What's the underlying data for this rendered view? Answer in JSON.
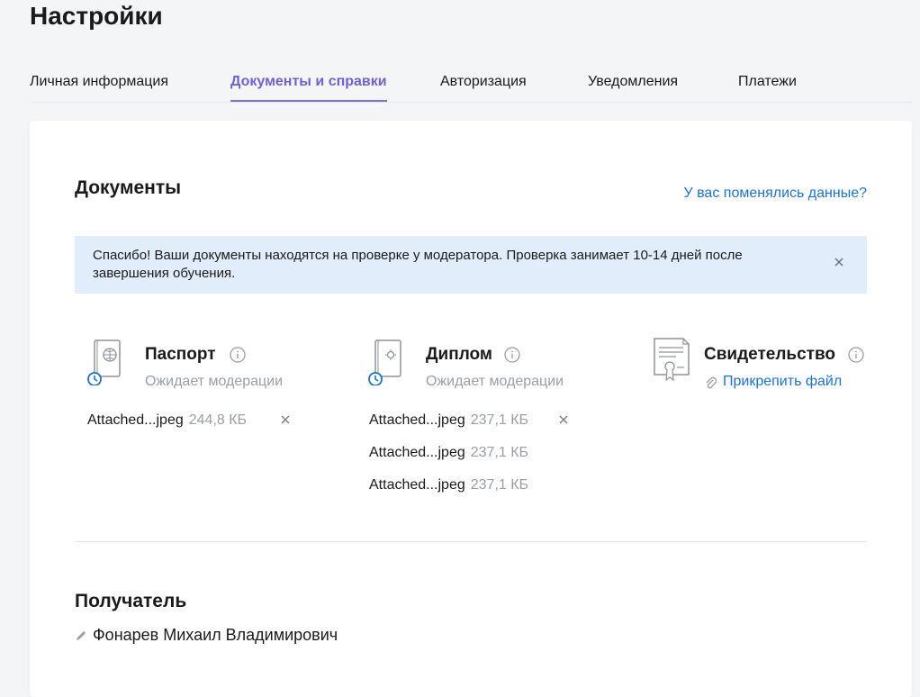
{
  "page": {
    "title": "Настройки"
  },
  "tabs": [
    {
      "label": "Личная информация",
      "active": false
    },
    {
      "label": "Документы и справки",
      "active": true
    },
    {
      "label": "Авторизация",
      "active": false
    },
    {
      "label": "Уведомления",
      "active": false
    },
    {
      "label": "Платежи",
      "active": false
    }
  ],
  "documents": {
    "title": "Документы",
    "changed_link": "У вас поменялись данные?",
    "notice": "Спасибо! Ваши документы находятся на проверке у модератора. Проверка занимает 10-14 дней после завершения обучения.",
    "notice_close_icon": "close-icon",
    "items": [
      {
        "name": "Паспорт",
        "status": "Ожидает модерации",
        "icon": "passport-icon",
        "files": [
          {
            "name": "Attached...jpeg",
            "size": "244,8 КБ",
            "removable": true
          }
        ]
      },
      {
        "name": "Диплом",
        "status": "Ожидает модерации",
        "icon": "diploma-icon",
        "files": [
          {
            "name": "Attached...jpeg",
            "size": "237,1 КБ",
            "removable": true
          },
          {
            "name": "Attached...jpeg",
            "size": "237,1 КБ",
            "removable": false
          },
          {
            "name": "Attached...jpeg",
            "size": "237,1 КБ",
            "removable": false
          }
        ]
      },
      {
        "name": "Свидетельство",
        "icon": "certificate-icon",
        "attach_label": "Прикрепить файл"
      }
    ]
  },
  "recipient": {
    "title": "Получатель",
    "name": "Фонарев Михаил Владимирович"
  },
  "colors": {
    "accent": "#7b6fe0",
    "link": "#1a73d8",
    "notice_bg": "#e2edfc",
    "pending_clock": "#1a6fd8",
    "muted": "#9a9ea5"
  }
}
